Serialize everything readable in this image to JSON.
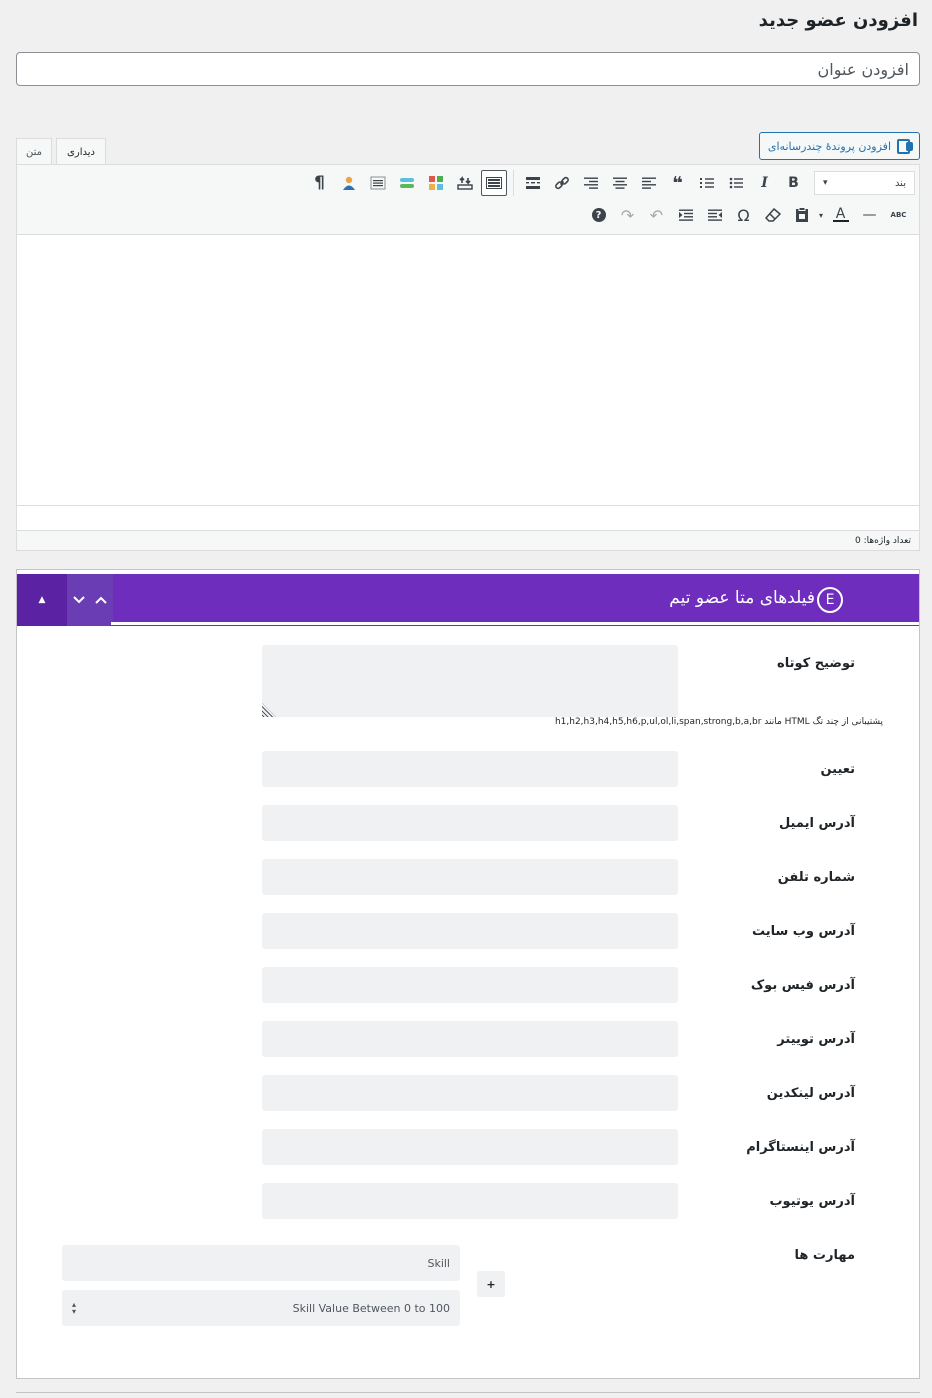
{
  "page": {
    "title": "افزودن عضو جدید"
  },
  "title_field": {
    "placeholder": "افزودن عنوان",
    "value": ""
  },
  "media": {
    "button_label": "افزودن پروندهٔ چندرسانه‌ای"
  },
  "editor": {
    "tabs": [
      {
        "label": "دیداری",
        "active": true
      },
      {
        "label": "متن",
        "active": false
      }
    ],
    "format_select": {
      "selected": "بند"
    },
    "toolbar_row1": [
      "bold-icon",
      "italic-icon",
      "bullet-list-icon",
      "numbered-list-icon",
      "blockquote-icon",
      "align-left-icon",
      "align-center-icon",
      "align-right-icon",
      "link-icon",
      "read-more-icon",
      "toolbar-toggle-icon",
      "upload-icon",
      "grid-blocks-icon",
      "layers-icon",
      "list-lines-icon",
      "user-icon",
      "paragraph-rtl-icon"
    ],
    "toolbar_row2": [
      "spellcheck-icon",
      "horizontal-line-icon",
      "text-color-icon",
      "paste-text-icon",
      "clear-format-icon",
      "special-char-icon",
      "outdent-icon",
      "indent-icon",
      "undo-icon",
      "redo-icon",
      "help-icon"
    ],
    "glyphs": {
      "bold": "B",
      "italic": "I",
      "blockquote": "❝",
      "omega": "Ω",
      "help": "?",
      "text_color": "A",
      "abc": "ABC",
      "paragraph": "¶",
      "undo": "↶",
      "redo": "↷",
      "link": "🔗",
      "dash": "—",
      "select_caret": "▾",
      "up_arrow": "▲",
      "chevron_down": "⌄",
      "chevron_up": "⌃"
    },
    "word_count": "تعداد واژه‌ها: 0"
  },
  "metabox": {
    "badge": "E",
    "title": "فیلدهای متا عضو تیم",
    "fields": {
      "short_desc": "توضیح کوتاه",
      "hint": "پشتیبانی از چند تگ HTML مانند h1,h2,h3,h4,h5,h6,p,ul,ol,li,span,strong,b,a,br",
      "designation": "تعیین",
      "email": "آدرس ایمیل",
      "phone": "شماره تلفن",
      "website": "آدرس وب سایت",
      "facebook": "آدرس فیس بوک",
      "twitter": "آدرس توییتر",
      "linkedin": "آدرس لینکدین",
      "instagram": "آدرس اینستاگرام",
      "youtube": "آدرس یوتیوب",
      "skills": "مهارت ها"
    },
    "skill": {
      "name_placeholder": "Skill",
      "value_placeholder": "Skill Value Between 0 to 100",
      "add_label": "+"
    }
  },
  "colors": {
    "accent": "#6f2dbd",
    "link_blue": "#2271b1"
  }
}
